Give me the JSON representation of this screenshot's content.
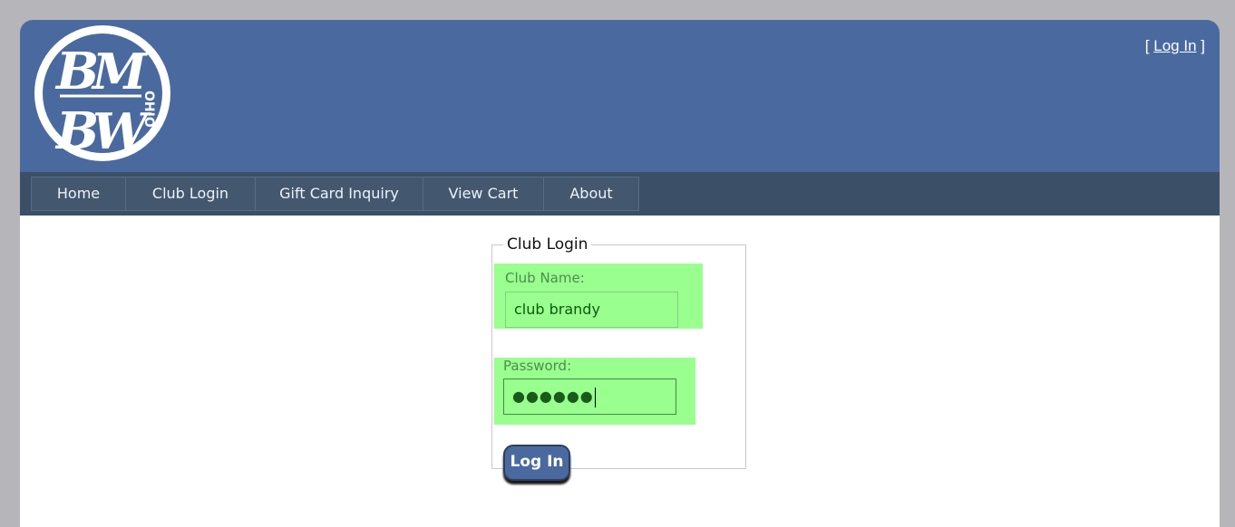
{
  "header": {
    "logo": {
      "icon": "bmbw-ohio-logo-icon",
      "letters": [
        "B",
        "M",
        "B",
        "W"
      ],
      "region_text": "OHIO"
    },
    "auth": {
      "bracket_open": "[",
      "link_label": "Log In",
      "bracket_close": "]"
    }
  },
  "nav": {
    "items": [
      {
        "label": "Home"
      },
      {
        "label": "Club Login"
      },
      {
        "label": "Gift Card Inquiry"
      },
      {
        "label": "View Cart"
      },
      {
        "label": "About"
      }
    ]
  },
  "login_form": {
    "legend": "Club Login",
    "club_name": {
      "label": "Club Name:",
      "value": "club brandy"
    },
    "password": {
      "label": "Password:",
      "value": "●●●●●●"
    },
    "submit_label": "Log In"
  },
  "colors": {
    "background": "#b6b6ba",
    "header": "#4a6a9f",
    "navbar": "#3b4f67",
    "highlight": "#99ff8f"
  }
}
